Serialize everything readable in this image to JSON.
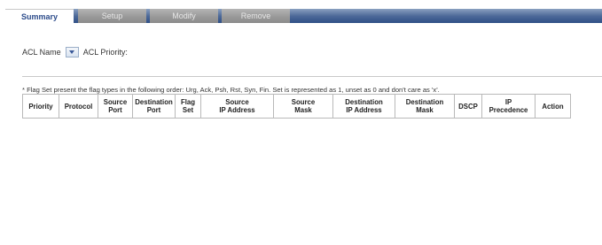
{
  "tabs": [
    {
      "label": "Summary"
    },
    {
      "label": "Setup"
    },
    {
      "label": "Modify"
    },
    {
      "label": "Remove"
    }
  ],
  "acl": {
    "name_label": "ACL Name",
    "priority_label": "ACL Priority:"
  },
  "note": "* Flag Set present the flag types in the following order: Urg, Ack, Psh, Rst, Syn, Fin. Set is represented as 1, unset as 0 and don't care as 'x'.",
  "table": {
    "columns": [
      "Priority",
      "Protocol",
      "Source\nPort",
      "Destination\nPort",
      "Flag\nSet",
      "Source\nIP Address",
      "Source\nMask",
      "Destination\nIP Address",
      "Destination\nMask",
      "DSCP",
      "IP\nPrecedence",
      "Action"
    ]
  },
  "colors": {
    "tab_bar": "#2f4f86",
    "tab_inactive": "#9a9a9a",
    "tab_active_text": "#2b4b8a"
  }
}
